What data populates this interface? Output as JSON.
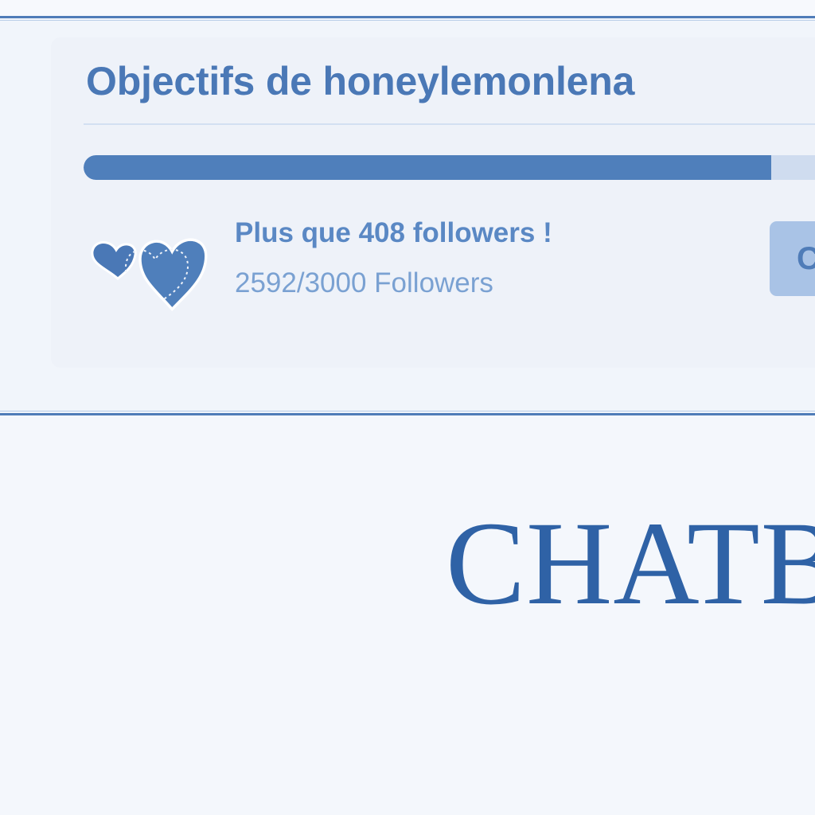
{
  "goals": {
    "title": "Objectifs de honeylemonlena",
    "goal_label": "Plus que 408 followers !",
    "goal_count": "2592/3000 Followers",
    "progress_fraction": 0.864,
    "progress_current": 2592,
    "progress_target": 3000,
    "button_label": "C",
    "goal_icon": "hearts-icon"
  },
  "chat": {
    "heading": "CHATB"
  },
  "colors": {
    "accent": "#4f7cb8",
    "progress_fill": "#4f7fbb",
    "progress_track": "#cfdcef",
    "heading": "#2f62a6",
    "background": "#f4f7fc"
  }
}
